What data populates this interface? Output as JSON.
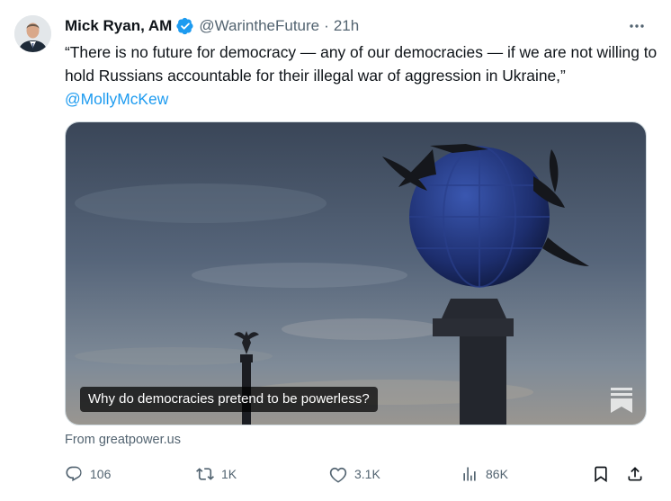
{
  "tweet": {
    "author_name": "Mick Ryan, AM",
    "handle": "@WarintheFuture",
    "separator": "·",
    "time": "21h",
    "text": "“There is no future for democracy — any of our democracies — if we are not willing to hold Russians accountable for their illegal war of aggression in Ukraine,” ",
    "mention": "@MollyMcKew",
    "media_caption": "Why do democracies pretend to be powerless?",
    "source": "From greatpower.us"
  },
  "actions": {
    "replies": "106",
    "reposts": "1K",
    "likes": "3.1K",
    "views": "86K"
  },
  "icons": {
    "verified": "verified-badge-icon",
    "more": "more-icon",
    "reply": "reply-icon",
    "repost": "repost-icon",
    "like": "heart-icon",
    "views": "views-icon",
    "bookmark": "bookmark-icon",
    "share": "share-icon"
  },
  "colors": {
    "text": "#0f1419",
    "secondary": "#536471",
    "link": "#1d9bf0",
    "verified": "#1d9bf0"
  }
}
